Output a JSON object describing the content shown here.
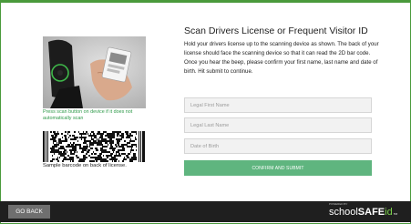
{
  "page": {
    "title": "Scan Drivers License or Frequent Visitor ID",
    "instructions": "Hold your drivers license up to the scanning device as shown. The back of your license should face the scanning device so that it can read the 2D bar code. Once you hear the beep, please confirm your first name, last name and date of birth. Hit submit to continue."
  },
  "left": {
    "scan_caption": "Press scan button on device if it does not automatically scan",
    "barcode_caption": "Sample barcode on back of license."
  },
  "form": {
    "first_name_placeholder": "Legal First Name",
    "last_name_placeholder": "Legal Last Name",
    "dob_placeholder": "Date of Birth",
    "submit_label": "CONFIRM AND SUBMIT"
  },
  "footer": {
    "go_back_label": "GO BACK",
    "powered_by": "POWERED BY",
    "logo_school": "school",
    "logo_safe": "SAFE",
    "logo_id": "id",
    "logo_tm": "TM"
  },
  "colors": {
    "frame_border": "#4a9a3c",
    "accent_button": "#5fb57f",
    "caption_green": "#2f9a4a",
    "footer_bg": "#1f1f1f",
    "logo_id": "#7bd04a"
  },
  "icons": {
    "scanner": "scanner-device-illustration",
    "barcode": "pdf417-barcode"
  }
}
